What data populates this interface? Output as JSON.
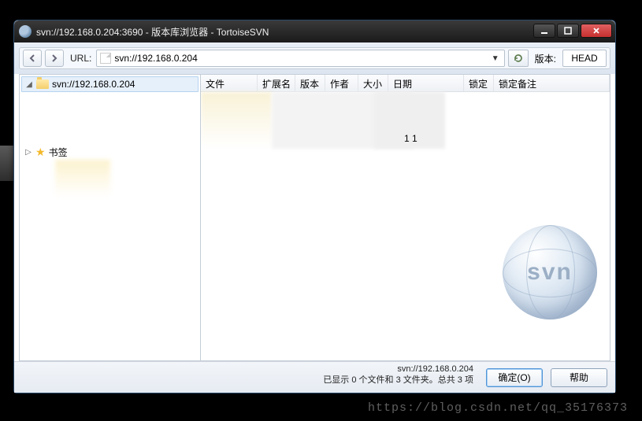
{
  "window": {
    "title": "svn://192.168.0.204:3690 - 版本库浏览器 - TortoiseSVN"
  },
  "toolbar": {
    "url_label": "URL:",
    "url_value": "svn://192.168.0.204",
    "revision_label": "版本:",
    "revision_value": "HEAD"
  },
  "tree": {
    "root_label": "svn://192.168.0.204",
    "bookmarks_label": "书签"
  },
  "columns": {
    "file": "文件",
    "ext": "扩展名",
    "rev": "版本",
    "author": "作者",
    "size": "大小",
    "date": "日期",
    "lock": "锁定",
    "lock_comment": "锁定备注"
  },
  "list": {
    "sample_cell": "1 1"
  },
  "footer": {
    "path": "svn://192.168.0.204",
    "status": "已显示 0 个文件和 3 文件夹。总共 3 项",
    "ok": "确定(O)",
    "help": "帮助"
  },
  "svn_logo_text": "svn",
  "blog_watermark": "https://blog.csdn.net/qq_35176373"
}
